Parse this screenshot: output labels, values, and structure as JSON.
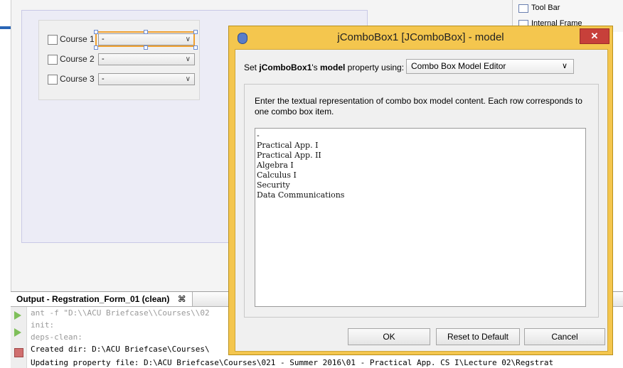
{
  "form": {
    "rows": [
      {
        "label": "Course 1",
        "value": "-"
      },
      {
        "label": "Course 2",
        "value": "-"
      },
      {
        "label": "Course 3",
        "value": "-"
      }
    ]
  },
  "palette": {
    "items": [
      "Tool Bar",
      "Internal Frame"
    ]
  },
  "output": {
    "tab_title": "Output - Regstration_Form_01 (clean)",
    "tab_close": "⌘",
    "lines": [
      "ant -f \"D:\\\\ACU Briefcase\\\\Courses\\\\02",
      "init:",
      "deps-clean:",
      "Created dir: D:\\ACU Briefcase\\Courses\\",
      "Updating property file: D:\\ACU Briefcase\\Courses\\021 - Summer 2016\\01 - Practical App. CS I\\Lecture 02\\Regstrat"
    ]
  },
  "dialog": {
    "title": "jComboBox1 [JComboBox] - model",
    "close_label": "✕",
    "set_prefix": "Set ",
    "component_name": "jComboBox1",
    "set_mid": "'s ",
    "property_name": "model",
    "set_suffix": " property using:",
    "editor_option": "Combo Box Model Editor",
    "description": "Enter the textual representation of combo box model content. Each row corresponds to one combo box item.",
    "items": [
      "-",
      "Practical App. I",
      "Practical App. II",
      "Algebra I",
      "Calculus I",
      "Security",
      "Data Communications"
    ],
    "buttons": {
      "ok": "OK",
      "reset": "Reset to Default",
      "cancel": "Cancel"
    }
  },
  "colors": {
    "dialog_frame": "#f4c64e",
    "close_button": "#c7403a",
    "selection": "#f0a030"
  }
}
